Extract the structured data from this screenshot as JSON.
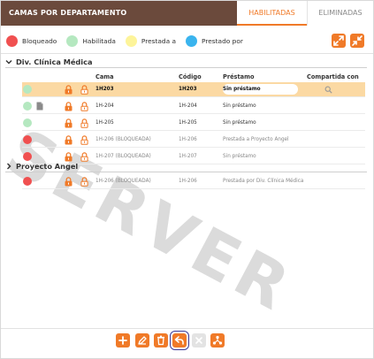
{
  "header": {
    "title": "CAMAS POR DEPARTAMENTO",
    "tabs": [
      {
        "label": "HABILITADAS",
        "active": true
      },
      {
        "label": "ELIMINADAS",
        "active": false
      }
    ]
  },
  "legend": [
    {
      "label": "Bloqueado",
      "color": "#f05050"
    },
    {
      "label": "Habilitada",
      "color": "#b5e8c0"
    },
    {
      "label": "Prestada a",
      "color": "#fdf49a"
    },
    {
      "label": "Prestado por",
      "color": "#3ab4ee"
    }
  ],
  "colors": {
    "accent": "#f07a28",
    "header_bg": "#6b4a3c",
    "selected_row": "#fbd9a3",
    "blocked": "#f05050",
    "enabled": "#b5e8c0"
  },
  "columns": {
    "cama": "Cama",
    "codigo": "Código",
    "prestamo": "Préstamo",
    "compartida": "Compartida con"
  },
  "groups": [
    {
      "name": "Div. Clínica Médica",
      "rows": [
        {
          "status": "enabled",
          "doc": false,
          "cama": "1H203",
          "codigo": "1H203",
          "prestamo": "Sin préstamo",
          "style": "bold",
          "selected": true
        },
        {
          "status": "enabled",
          "doc": true,
          "cama": "1H-204",
          "codigo": "1H-204",
          "prestamo": "Sin préstamo",
          "style": "normal",
          "selected": false
        },
        {
          "status": "enabled",
          "doc": false,
          "cama": "1H-205",
          "codigo": "1H-205",
          "prestamo": "Sin préstamo",
          "style": "normal",
          "selected": false
        },
        {
          "status": "blocked",
          "doc": false,
          "cama": "1H-206 (BLOQUEADA)",
          "codigo": "1H-206",
          "prestamo": "Prestada a Proyecto Angel",
          "style": "muted",
          "selected": false
        },
        {
          "status": "blocked",
          "doc": false,
          "cama": "1H-207 (BLOQUEADA)",
          "codigo": "1H-207",
          "prestamo": "Sin préstamo",
          "style": "muted",
          "selected": false
        }
      ]
    },
    {
      "name": "Proyecto Angel",
      "rows": [
        {
          "status": "blocked",
          "doc": false,
          "cama": "1H-206 (BLOQUEADA)",
          "codigo": "1H-206",
          "prestamo": "Prestada por Div. Clínica Médica",
          "style": "muted",
          "selected": false
        }
      ]
    }
  ],
  "watermark": "SERVER",
  "toolbar": [
    {
      "icon": "plus-icon",
      "disabled": false
    },
    {
      "icon": "pencil-icon",
      "disabled": false
    },
    {
      "icon": "trash-icon",
      "disabled": false
    },
    {
      "icon": "undo-icon",
      "disabled": false
    },
    {
      "icon": "close-icon",
      "disabled": true
    },
    {
      "icon": "share-icon",
      "disabled": false
    }
  ]
}
